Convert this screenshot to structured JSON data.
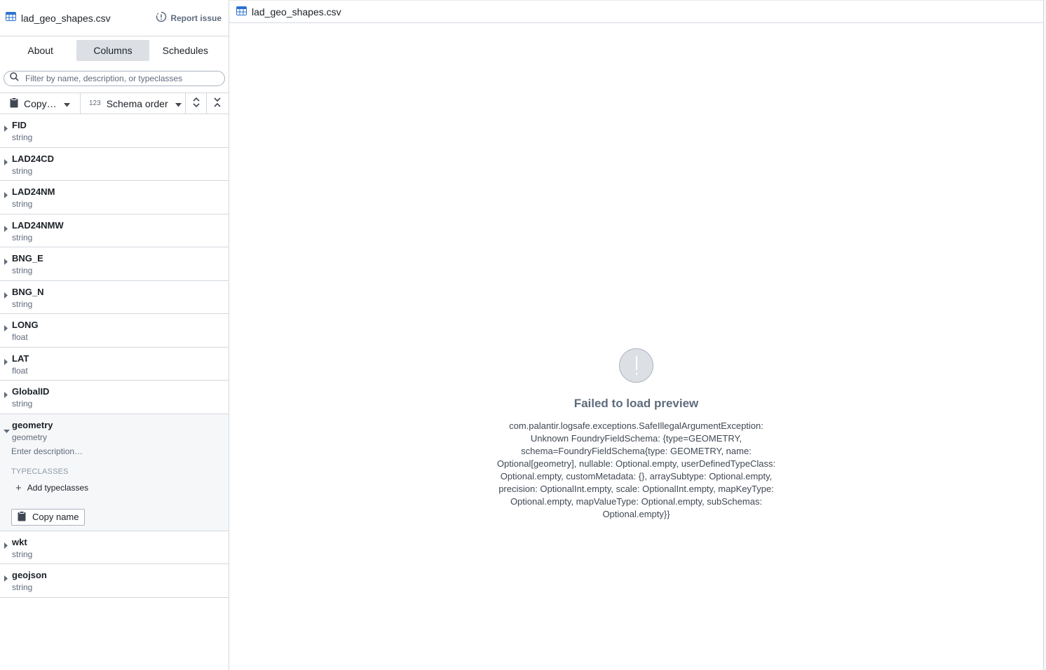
{
  "sidebar": {
    "file_title": "lad_geo_shapes.csv",
    "report_issue": "Report issue",
    "tabs": [
      {
        "label": "About"
      },
      {
        "label": "Columns"
      },
      {
        "label": "Schedules"
      }
    ],
    "active_tab": "Columns",
    "search": {
      "placeholder": "Filter by name, description, or typeclasses",
      "value": ""
    },
    "toolbar": {
      "copy_label": "Copy…",
      "sort_prefix": "123",
      "sort_label": "Schema order"
    },
    "columns_before": [
      {
        "name": "FID",
        "type": "string"
      },
      {
        "name": "LAD24CD",
        "type": "string"
      },
      {
        "name": "LAD24NM",
        "type": "string"
      },
      {
        "name": "LAD24NMW",
        "type": "string"
      },
      {
        "name": "BNG_E",
        "type": "string"
      },
      {
        "name": "BNG_N",
        "type": "string"
      },
      {
        "name": "LONG",
        "type": "float"
      },
      {
        "name": "LAT",
        "type": "float"
      },
      {
        "name": "GlobalID",
        "type": "string"
      }
    ],
    "expanded_column": {
      "name": "geometry",
      "type": "geometry",
      "description_placeholder": "Enter description…",
      "typeclasses_heading": "TYPECLASSES",
      "add_typeclasses": "Add typeclasses",
      "copy_name": "Copy name"
    },
    "columns_after": [
      {
        "name": "wkt",
        "type": "string"
      },
      {
        "name": "geojson",
        "type": "string"
      }
    ]
  },
  "main": {
    "tab_title": "lad_geo_shapes.csv",
    "error": {
      "heading": "Failed to load preview",
      "message": "com.palantir.logsafe.exceptions.SafeIllegalArgumentException: Unknown FoundryFieldSchema: {type=GEOMETRY, schema=FoundryFieldSchema{type: GEOMETRY, name: Optional[geometry], nullable: Optional.empty, userDefinedTypeClass: Optional.empty, customMetadata: {}, arraySubtype: Optional.empty, precision: OptionalInt.empty, scale: OptionalInt.empty, mapKeyType: Optional.empty, mapValueType: Optional.empty, subSchemas: Optional.empty}}"
    }
  },
  "colors": {
    "accent": "#2d72d2",
    "active_tab_bg": "#dce0e5",
    "muted_text": "#5f6b7c",
    "border": "#d3d8de"
  }
}
